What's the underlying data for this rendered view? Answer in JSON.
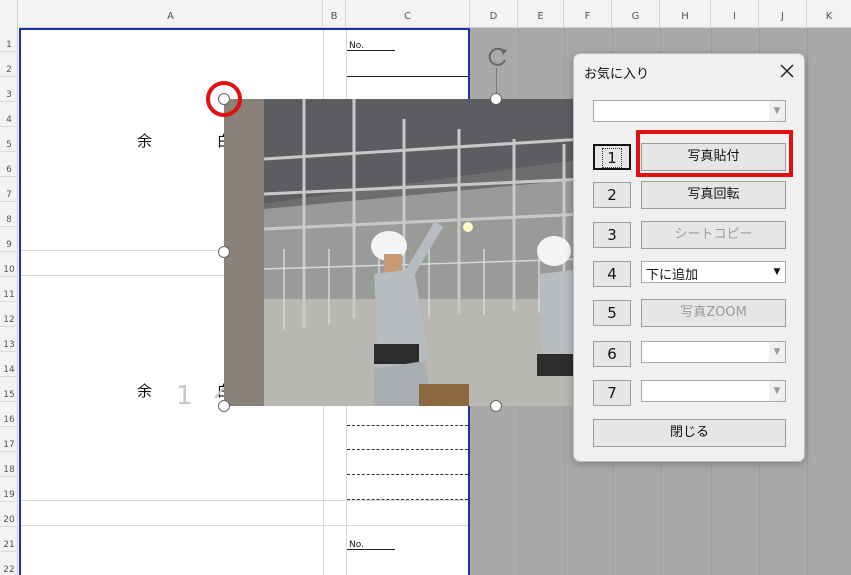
{
  "columns": [
    "A",
    "B",
    "C",
    "D",
    "E",
    "F",
    "G",
    "H",
    "I",
    "J",
    "K"
  ],
  "rows": [
    "1",
    "2",
    "3",
    "4",
    "5",
    "6",
    "7",
    "8",
    "9",
    "10",
    "11",
    "12",
    "13",
    "14",
    "15",
    "16",
    "17",
    "18",
    "19",
    "20",
    "21",
    "22"
  ],
  "sheet": {
    "margin_label_top": "余 白",
    "margin_label_bottom": "余 白",
    "no_label_top": "No.",
    "no_label_bottom": "No.",
    "faded_text": "1 ヘ ノ"
  },
  "dialog": {
    "title": "お気に入り",
    "top_combo_value": "",
    "buttons": [
      {
        "number": "1",
        "label": "写真貼付"
      },
      {
        "number": "2",
        "label": "写真回転"
      },
      {
        "number": "3",
        "label": "シートコピー"
      },
      {
        "number": "4",
        "label": "下に追加"
      },
      {
        "number": "5",
        "label": "写真ZOOM"
      },
      {
        "number": "6",
        "label": ""
      },
      {
        "number": "7",
        "label": ""
      }
    ],
    "close_label": "閉じる"
  },
  "colors": {
    "print_border": "#1f2fa5",
    "highlight_red": "#e01010",
    "gray_area": "#a9a9a9"
  }
}
